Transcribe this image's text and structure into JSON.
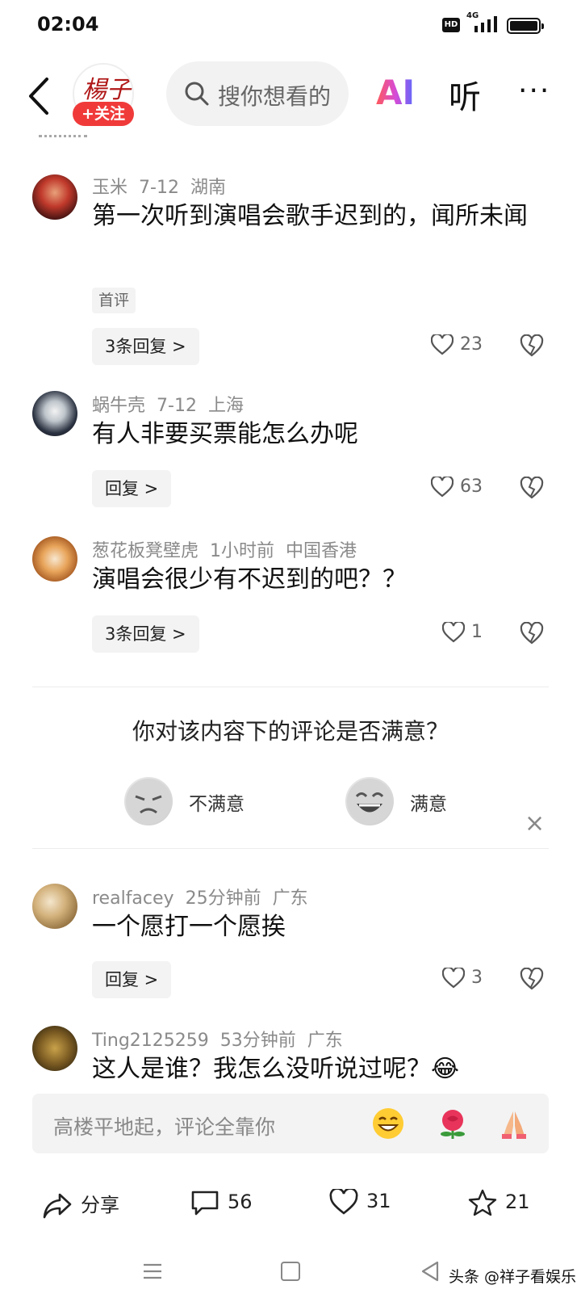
{
  "status": {
    "time": "02:04",
    "hd": "HD",
    "network": "4G"
  },
  "topnav": {
    "follow_label": "+关注",
    "search_placeholder": "搜你想看的",
    "ai_label": "AI",
    "listen_label": "听",
    "more_label": "···",
    "avatar_text": "楊子"
  },
  "comments": [
    {
      "user": "玉米",
      "date": "7-12",
      "location": "湖南",
      "text": "第一次听到演唱会歌手迟到的，闻所未闻",
      "tag": "首评",
      "reply": "3条回复 >",
      "likes": "23"
    },
    {
      "user": "蜗牛壳",
      "date": "7-12",
      "location": "上海",
      "text": "有人非要买票能怎么办呢",
      "reply": "回复 >",
      "likes": "63"
    },
    {
      "user": "葱花板凳壁虎",
      "date": "1小时前",
      "location": "中国香港",
      "text": "演唱会很少有不迟到的吧？？",
      "reply": "3条回复 >",
      "likes": "1"
    },
    {
      "user": "realfacey",
      "date": "25分钟前",
      "location": "广东",
      "text": "一个愿打一个愿挨",
      "reply": "回复 >",
      "likes": "3"
    },
    {
      "user": "Ting2125259",
      "date": "53分钟前",
      "location": "广东",
      "text": "这人是谁？我怎么没听说过呢？😂"
    }
  ],
  "survey": {
    "question": "你对该内容下的评论是否满意？",
    "unsatisfied": "不满意",
    "satisfied": "满意",
    "close": "×"
  },
  "input": {
    "placeholder": "高楼平地起，评论全靠你"
  },
  "actions": {
    "share": "分享",
    "comments": "56",
    "likes": "31",
    "favorites": "21"
  },
  "watermark": "头条 @祥子看娱乐"
}
